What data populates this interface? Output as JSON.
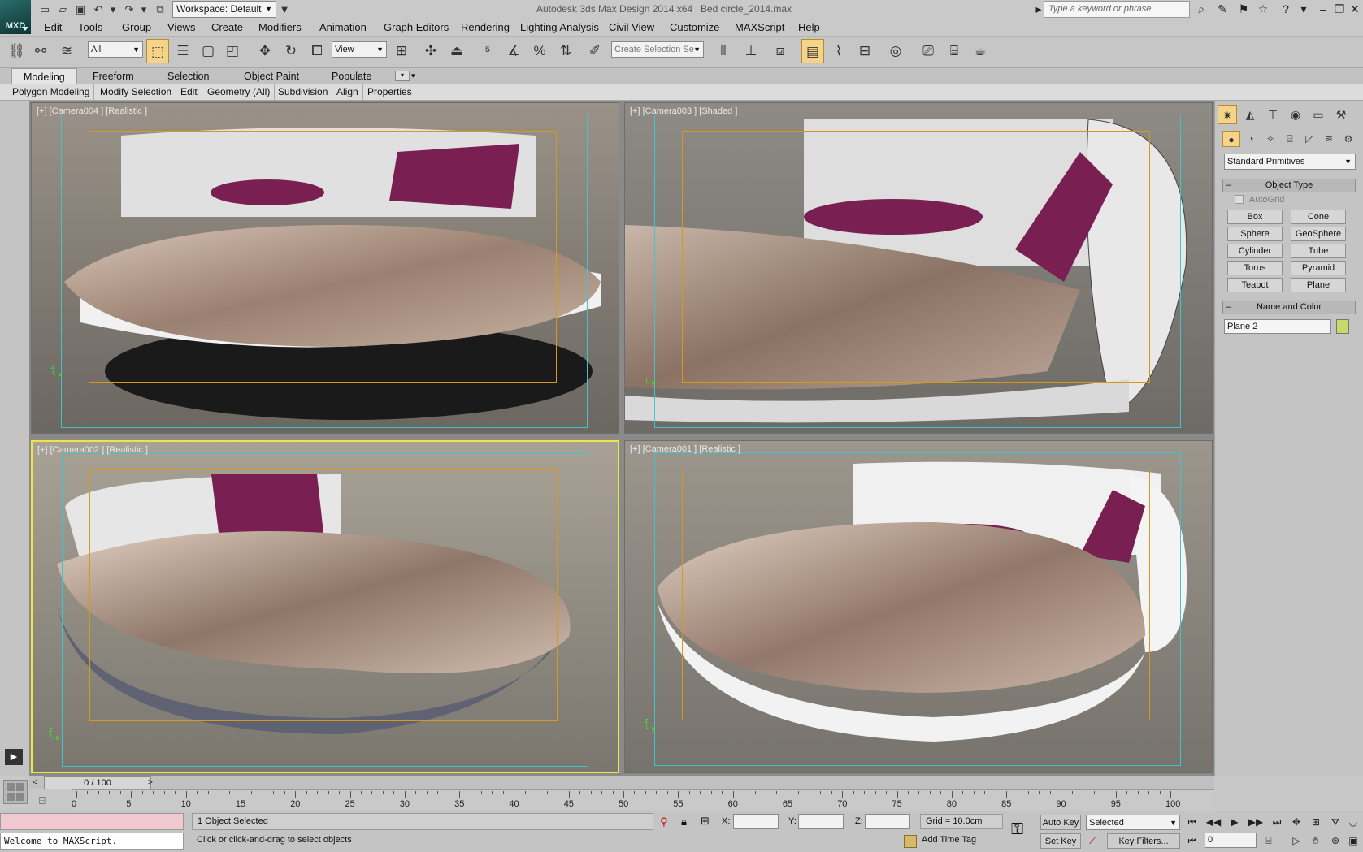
{
  "app": {
    "logo_text": "MXD",
    "workspace": "Workspace: Default",
    "title": "Autodesk 3ds Max Design 2014 x64",
    "document": "Bed circle_2014.max",
    "search_placeholder": "Type a keyword or phrase"
  },
  "menu": [
    "Edit",
    "Tools",
    "Group",
    "Views",
    "Create",
    "Modifiers",
    "Animation",
    "Graph Editors",
    "Rendering",
    "Lighting Analysis",
    "Civil View",
    "Customize",
    "MAXScript",
    "Help"
  ],
  "toolbar": {
    "filter": "All",
    "ref_coord": "View",
    "named_selection": "Create Selection Se"
  },
  "ribbon": {
    "tabs": [
      "Modeling",
      "Freeform",
      "Selection",
      "Object Paint",
      "Populate"
    ],
    "active_tab": "Modeling",
    "panels": [
      "Polygon Modeling",
      "Modify Selection",
      "Edit",
      "Geometry (All)",
      "Subdivision",
      "Align",
      "Properties"
    ]
  },
  "viewports": [
    {
      "label": "[+] [Camera004 ] [Realistic ]",
      "active": false
    },
    {
      "label": "[+] [Camera003 ] [Shaded ]",
      "active": false
    },
    {
      "label": "[+] [Camera002 ] [Realistic ]",
      "active": true
    },
    {
      "label": "[+] [Camera001 ] [Realistic ]",
      "active": false
    }
  ],
  "command_panel": {
    "category": "Standard Primitives",
    "object_type_title": "Object Type",
    "autogrid": "AutoGrid",
    "primitives": [
      "Box",
      "Cone",
      "Sphere",
      "GeoSphere",
      "Cylinder",
      "Tube",
      "Torus",
      "Pyramid",
      "Teapot",
      "Plane"
    ],
    "name_color_title": "Name and Color",
    "object_name": "Plane 2",
    "object_color": "#c8da6a"
  },
  "timeline": {
    "position": "0 / 100",
    "ticks": [
      "0",
      "5",
      "10",
      "15",
      "20",
      "25",
      "30",
      "35",
      "40",
      "45",
      "50",
      "55",
      "60",
      "65",
      "70",
      "75",
      "80",
      "85",
      "90",
      "95",
      "100"
    ]
  },
  "status": {
    "maxscript_output": "Welcome to MAXScript.",
    "selection": "1 Object Selected",
    "prompt": "Click or click-and-drag to select objects",
    "x_label": "X:",
    "y_label": "Y:",
    "z_label": "Z:",
    "grid": "Grid = 10.0cm",
    "add_time_tag": "Add Time Tag",
    "auto_key": "Auto Key",
    "set_key": "Set Key",
    "key_mode": "Selected",
    "key_filters": "Key Filters...",
    "current_frame": "0"
  },
  "colors": {
    "accent": "#f5d48a",
    "active_viewport_border": "#f2e542",
    "frame_line": "#3fc4d0",
    "safe_frame": "#d49a1e",
    "blanket": "#b59a8a",
    "pillow": "#7a1f52",
    "headboard": "#e6e6e6"
  },
  "icons": [
    "search-icon",
    "binoculars-icon",
    "star-icon",
    "help-icon",
    "minimize-icon",
    "maximize-icon",
    "close-icon",
    "lock-icon",
    "key-icon",
    "play-icon"
  ]
}
